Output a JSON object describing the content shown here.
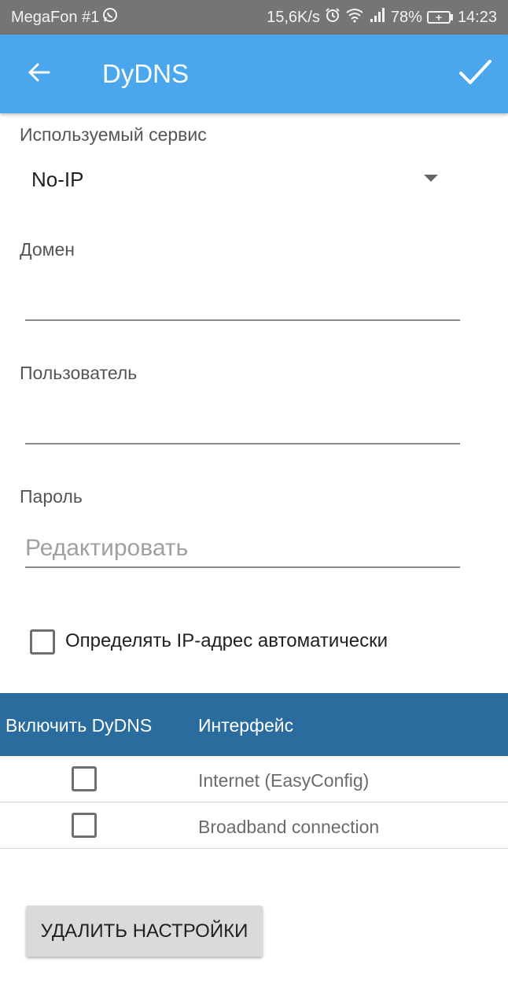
{
  "status_bar": {
    "carrier": "MegaFon #1",
    "speed": "15,6K/s",
    "battery": "78%",
    "time": "14:23",
    "icons": [
      "whatsapp-icon",
      "alarm-icon",
      "wifi-icon",
      "signal-icon",
      "battery-charging-icon"
    ]
  },
  "app_bar": {
    "title": "DyDNS",
    "back_icon": "arrow-back-icon",
    "save_icon": "check-icon",
    "color": "#4aa7ee"
  },
  "form": {
    "service": {
      "label": "Используемый сервис",
      "value": "No-IP"
    },
    "domain": {
      "label": "Домен",
      "value": "",
      "placeholder": ""
    },
    "user": {
      "label": "Пользователь",
      "value": "",
      "placeholder": ""
    },
    "password": {
      "label": "Пароль",
      "value": "",
      "placeholder": "Редактировать"
    },
    "auto_ip": {
      "label": "Определять IP-адрес автоматически",
      "checked": false
    }
  },
  "interfaces_table": {
    "header_color": "#2b6c9e",
    "columns": [
      "Включить DyDNS",
      "Интерфейс"
    ],
    "rows": [
      {
        "enabled": false,
        "interface": "Internet (EasyConfig)"
      },
      {
        "enabled": false,
        "interface": "Broadband connection"
      }
    ]
  },
  "actions": {
    "delete_label": "УДАЛИТЬ НАСТРОЙКИ"
  }
}
